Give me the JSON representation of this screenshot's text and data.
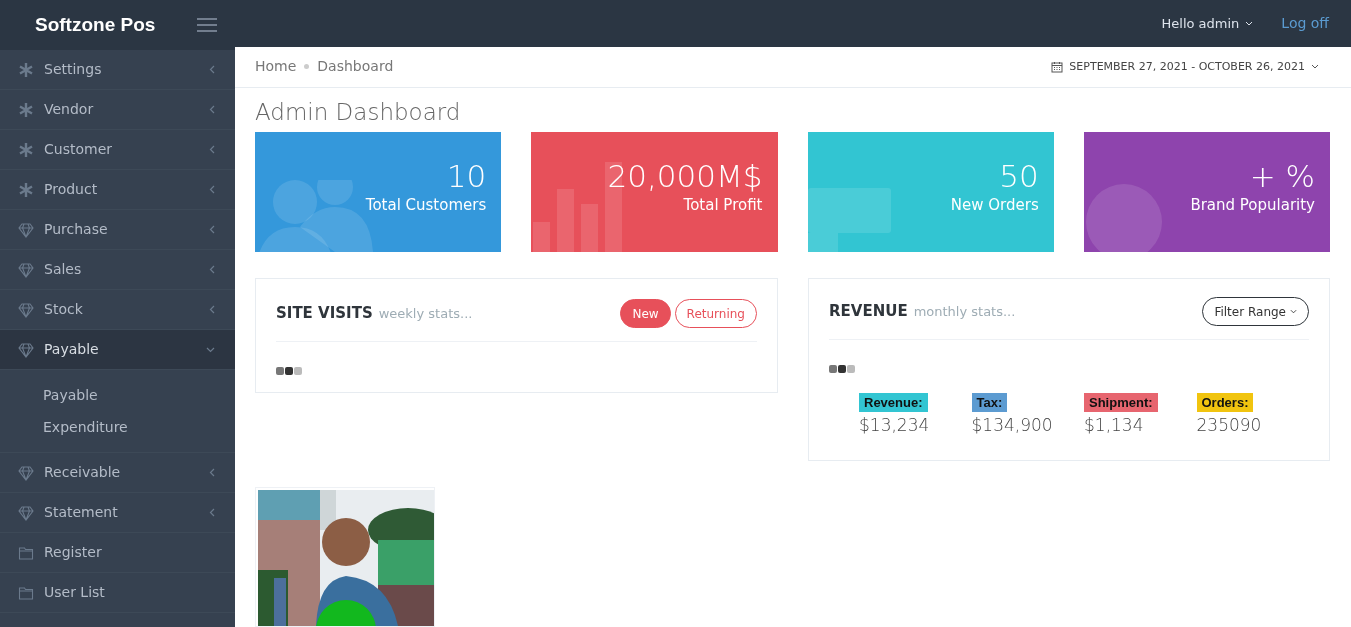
{
  "brand": "Softzone Pos",
  "header": {
    "greeting": "Hello admin",
    "logout": "Log off"
  },
  "sidebar": {
    "items": [
      {
        "label": "Settings",
        "kind": "asterisk",
        "expanded": false
      },
      {
        "label": "Vendor",
        "kind": "asterisk",
        "expanded": false
      },
      {
        "label": "Customer",
        "kind": "asterisk",
        "expanded": false
      },
      {
        "label": "Product",
        "kind": "asterisk",
        "expanded": false
      },
      {
        "label": "Purchase",
        "kind": "diamond",
        "expanded": false
      },
      {
        "label": "Sales",
        "kind": "diamond",
        "expanded": false
      },
      {
        "label": "Stock",
        "kind": "diamond",
        "expanded": false
      },
      {
        "label": "Payable",
        "kind": "diamond",
        "expanded": true,
        "children": [
          {
            "label": "Payable"
          },
          {
            "label": "Expenditure"
          }
        ]
      },
      {
        "label": "Receivable",
        "kind": "diamond",
        "expanded": false
      },
      {
        "label": "Statement",
        "kind": "diamond",
        "expanded": false
      },
      {
        "label": "Register",
        "kind": "folder"
      },
      {
        "label": "User List",
        "kind": "folder"
      }
    ]
  },
  "breadcrumb": [
    "Home",
    "Dashboard"
  ],
  "date_range": "SEPTEMBER 27, 2021 - OCTOBER 26, 2021",
  "page_title": "Admin Dashboard",
  "stats": [
    {
      "value": "10",
      "label": "Total Customers",
      "color": "#3498db",
      "kind": "users"
    },
    {
      "value": "20,000M$",
      "label": "Total Profit",
      "color": "#e7505a",
      "kind": "bars"
    },
    {
      "value": "50",
      "label": "New Orders",
      "color": "#32c5d2",
      "kind": "screen"
    },
    {
      "value": "+ %",
      "label": "Brand Popularity",
      "color": "#8e44ad",
      "kind": "globe"
    }
  ],
  "site_visits": {
    "title": "SITE VISITS",
    "subtitle": "weekly stats...",
    "toggles": [
      {
        "label": "New",
        "selected": true
      },
      {
        "label": "Returning",
        "selected": false
      }
    ]
  },
  "revenue": {
    "title": "REVENUE",
    "subtitle": "monthly stats...",
    "filter": "Filter Range",
    "metrics": [
      {
        "label": "Revenue:",
        "value": "$13,234",
        "color": "#32c5d2"
      },
      {
        "label": "Tax:",
        "value": "$134,900",
        "color": "#5c9bd1"
      },
      {
        "label": "Shipment:",
        "value": "$1,134",
        "color": "#e7656f"
      },
      {
        "label": "Orders:",
        "value": "235090",
        "color": "#f1c40f"
      }
    ]
  }
}
